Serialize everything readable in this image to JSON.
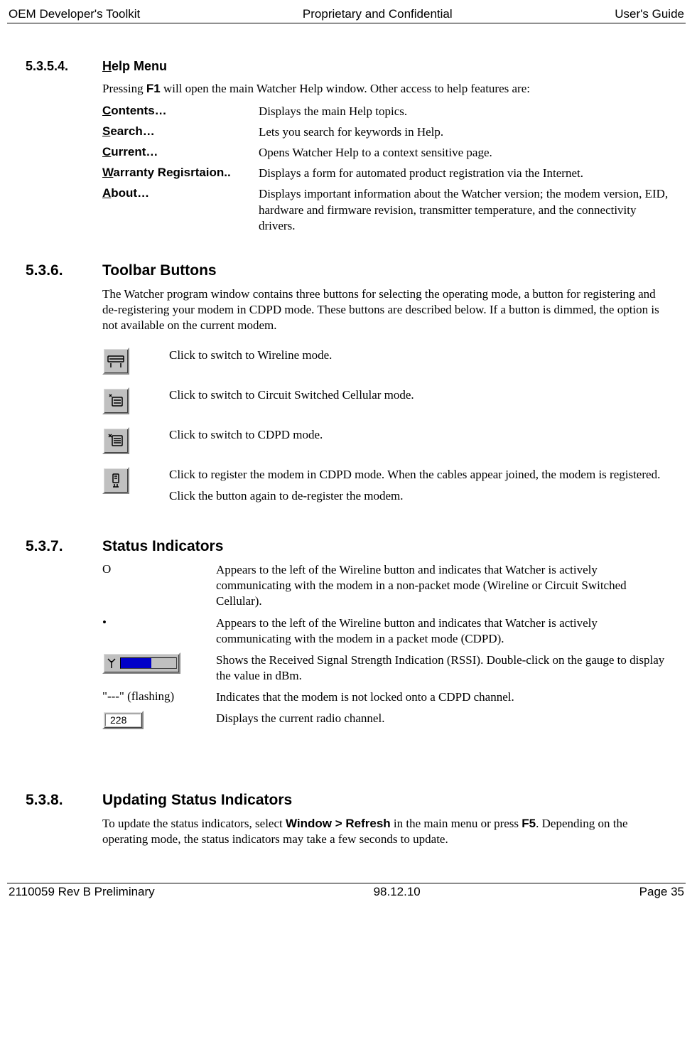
{
  "header": {
    "left": "OEM Developer's Toolkit",
    "center": "Proprietary and Confidential",
    "right": "User's Guide"
  },
  "footer": {
    "left": "2110059 Rev B Preliminary",
    "center": "98.12.10",
    "right": "Page 35"
  },
  "s5354": {
    "num": "5.3.5.4.",
    "title_u": "H",
    "title_rest": "elp Menu",
    "intro_pre": "Pressing ",
    "intro_bold": "F1",
    "intro_post": " will open the main Watcher Help window.  Other access to help features are:",
    "items": [
      {
        "u": "C",
        "rest": "ontents…",
        "desc": "Displays the main Help topics."
      },
      {
        "u": "S",
        "rest": "earch…",
        "desc": "Lets you search for keywords in Help."
      },
      {
        "u": "C",
        "rest": "urrent…",
        "desc": "Opens Watcher Help to a context sensitive page."
      },
      {
        "u": "W",
        "rest": "arranty Regisrtaion..",
        "desc": "Displays a form for automated product registration via the Internet."
      },
      {
        "u": "A",
        "rest": "bout…",
        "desc": "Displays important information about the Watcher version; the modem version, EID, hardware and firmware revision, transmitter temperature, and the connectivity drivers."
      }
    ]
  },
  "s536": {
    "num": "5.3.6.",
    "title": "Toolbar Buttons",
    "intro": "The Watcher program window contains three buttons for selecting the operating mode, a button for registering and de-registering your modem in CDPD mode.  These buttons are described below.  If a button is dimmed, the option is not available on the current modem.",
    "rows": [
      {
        "icon": "wireline",
        "desc1": "Click to switch to Wireline mode."
      },
      {
        "icon": "circuit",
        "desc1": "Click to switch to Circuit Switched Cellular mode."
      },
      {
        "icon": "cdpd",
        "desc1": "Click to switch to CDPD mode."
      },
      {
        "icon": "register",
        "desc1": "Click to register the modem in CDPD mode.  When the cables appear joined, the modem is registered.",
        "desc2": "Click the button again to de-register the modem."
      }
    ]
  },
  "s537": {
    "num": "5.3.7.",
    "title": "Status Indicators",
    "rows": [
      {
        "term_type": "text",
        "term": "O",
        "desc": "Appears to the left of the Wireline button and indicates that Watcher is actively communicating with the modem in a non-packet mode (Wireline or Circuit Switched Cellular)."
      },
      {
        "term_type": "text",
        "term": "•",
        "desc": "Appears to the left of the Wireline button and indicates that Watcher is actively communicating with the modem in a packet mode (CDPD)."
      },
      {
        "term_type": "rssi",
        "desc": "Shows the Received Signal Strength Indication (RSSI). Double-click on the gauge to display the value in dBm."
      },
      {
        "term_type": "text",
        "term": " \"---\" (flashing)",
        "desc": "Indicates that the modem is not locked onto a CDPD channel."
      },
      {
        "term_type": "channel",
        "term": "228",
        "desc": "Displays the current radio channel."
      }
    ]
  },
  "s538": {
    "num": "5.3.8.",
    "title": "Updating Status Indicators",
    "p_pre": "To update the status indicators, select ",
    "p_bold1": "Window > Refresh",
    "p_mid": " in the main menu or press ",
    "p_bold2": "F5",
    "p_post": ". Depending on the operating mode, the status indicators may take a few seconds to update."
  }
}
